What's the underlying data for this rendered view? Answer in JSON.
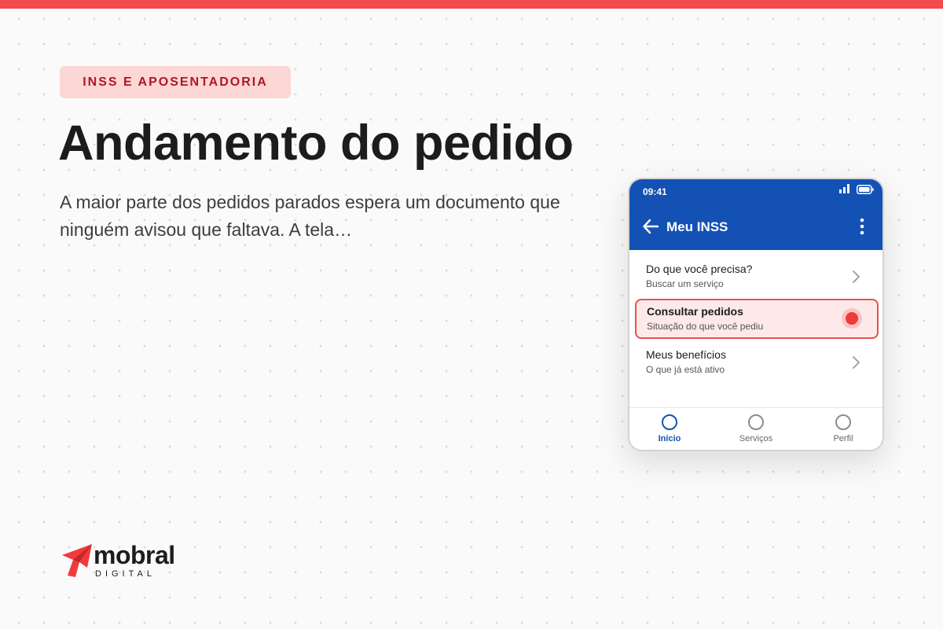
{
  "tag": "INSS E APOSENTADORIA",
  "title": "Andamento do pedido",
  "lede": "A maior parte dos pedidos parados espera um documento que ninguém avisou que faltava. A tela…",
  "logo": {
    "name": "mobral",
    "sub": "DIGITAL"
  },
  "colors": {
    "accent": "#f24b4b",
    "app_blue": "#1451b4",
    "tag_bg": "#fdd6d6",
    "tag_text": "#b01622"
  },
  "phone": {
    "status_time": "09:41",
    "app_title": "Meu INSS",
    "items": [
      {
        "title": "Do que você precisa?",
        "subtitle": "Buscar um serviço",
        "icon": "chevron-right-icon"
      },
      {
        "title": "Consultar pedidos",
        "subtitle": "Situação do que você pediu",
        "highlighted": true,
        "icon": "tap-indicator-icon"
      },
      {
        "title": "Meus benefícios",
        "subtitle": "O que já está ativo",
        "icon": "chevron-right-icon"
      }
    ],
    "nav": [
      {
        "label": "Início",
        "active": true
      },
      {
        "label": "Serviços",
        "active": false
      },
      {
        "label": "Perfil",
        "active": false
      }
    ]
  }
}
